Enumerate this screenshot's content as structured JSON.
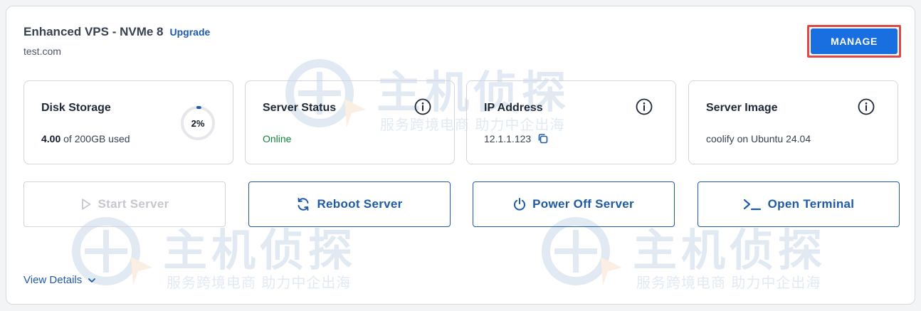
{
  "service": {
    "plan_name": "Enhanced VPS - NVMe 8",
    "upgrade_label": "Upgrade",
    "domain": "test.com",
    "manage_label": "MANAGE"
  },
  "stats": {
    "disk": {
      "label": "Disk Storage",
      "used": "4.00",
      "total_text": "of 200GB used",
      "percent_label": "2%",
      "percent": 2
    },
    "status": {
      "label": "Server Status",
      "value": "Online"
    },
    "ip": {
      "label": "IP Address",
      "value": "12.1.1.123"
    },
    "image": {
      "label": "Server Image",
      "value": "coolify on Ubuntu 24.04"
    }
  },
  "actions": {
    "start": "Start Server",
    "reboot": "Reboot Server",
    "power_off": "Power Off Server",
    "terminal": "Open Terminal"
  },
  "view_details_label": "View Details",
  "watermark": {
    "title": "主机侦探",
    "subtitle": "服务跨境电商 助力中企出海"
  },
  "colors": {
    "primary": "#1e5aa8",
    "manage_button": "#1a6fe0",
    "highlight_border": "#e04848",
    "online": "#15803d"
  }
}
